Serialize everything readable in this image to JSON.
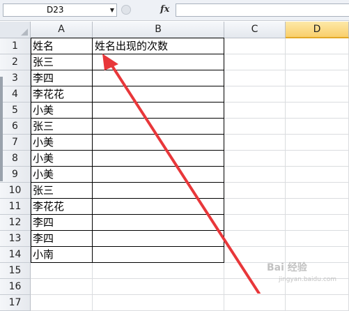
{
  "formula_bar": {
    "name_box": "D23",
    "fx_label": "fx",
    "formula": ""
  },
  "columns": [
    {
      "label": "A"
    },
    {
      "label": "B"
    },
    {
      "label": "C"
    },
    {
      "label": "D"
    }
  ],
  "rows": [
    {
      "num": "1",
      "a": "姓名",
      "b": "姓名出现的次数"
    },
    {
      "num": "2",
      "a": "张三",
      "b": ""
    },
    {
      "num": "3",
      "a": "李四",
      "b": ""
    },
    {
      "num": "4",
      "a": "李花花",
      "b": ""
    },
    {
      "num": "5",
      "a": "小美",
      "b": ""
    },
    {
      "num": "6",
      "a": "张三",
      "b": ""
    },
    {
      "num": "7",
      "a": "小美",
      "b": ""
    },
    {
      "num": "8",
      "a": "小美",
      "b": ""
    },
    {
      "num": "9",
      "a": "小美",
      "b": ""
    },
    {
      "num": "10",
      "a": "张三",
      "b": ""
    },
    {
      "num": "11",
      "a": "李花花",
      "b": ""
    },
    {
      "num": "12",
      "a": "李四",
      "b": ""
    },
    {
      "num": "13",
      "a": "李四",
      "b": ""
    },
    {
      "num": "14",
      "a": "小南",
      "b": ""
    },
    {
      "num": "15",
      "a": "",
      "b": ""
    },
    {
      "num": "16",
      "a": "",
      "b": ""
    },
    {
      "num": "17",
      "a": "",
      "b": ""
    }
  ],
  "selected_column": "D",
  "watermark": "Bai 经验",
  "watermark_sub": "jingyan.baidu.com",
  "colors": {
    "selected_header": "#f9cf6b",
    "arrow": "#e8373a"
  }
}
